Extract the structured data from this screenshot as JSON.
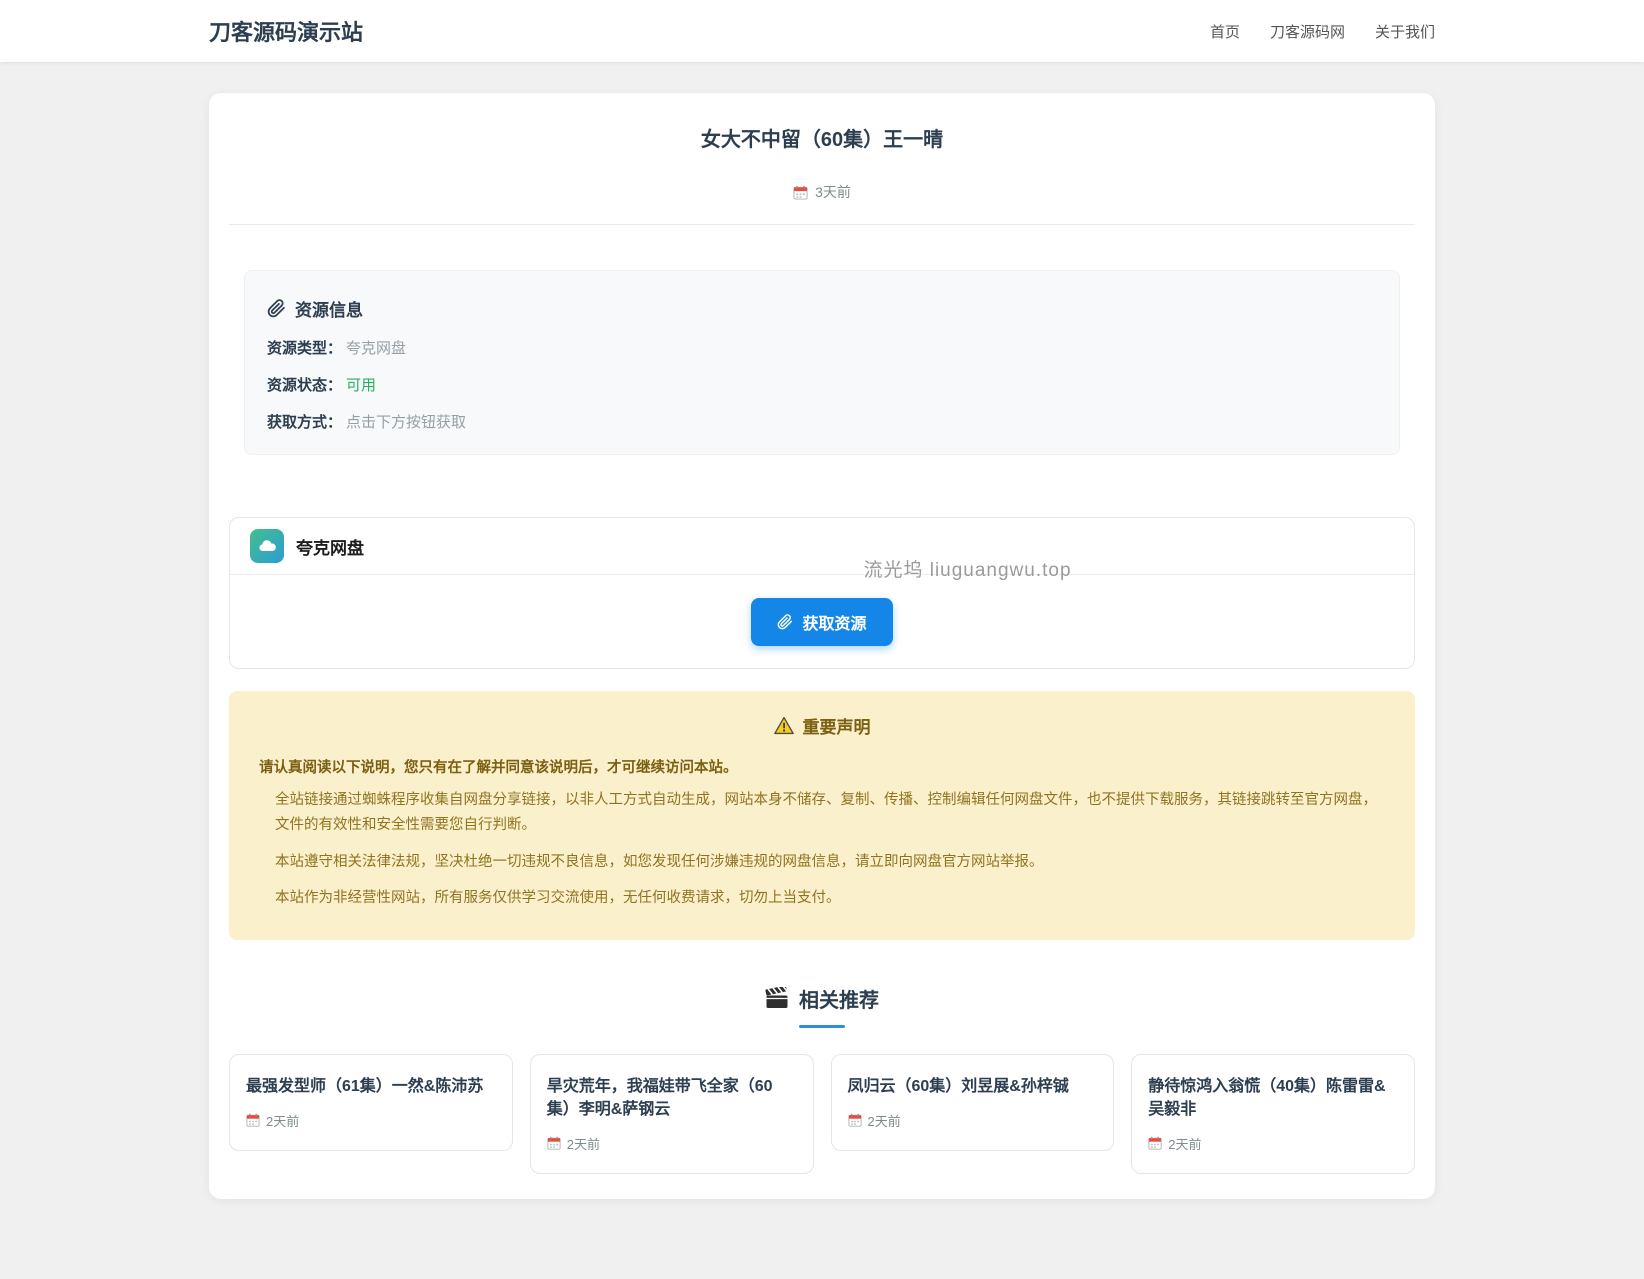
{
  "header": {
    "site_title": "刀客源码演示站",
    "nav": [
      "首页",
      "刀客源码网",
      "关于我们"
    ]
  },
  "article": {
    "title": "女大不中留（60集）王一晴",
    "date": "3天前"
  },
  "resource_info": {
    "heading": "资源信息",
    "fields": [
      {
        "label": "资源类型：",
        "value": "夸克网盘"
      },
      {
        "label": "资源状态：",
        "value": "可用"
      },
      {
        "label": "获取方式：",
        "value": "点击下方按钮获取"
      }
    ]
  },
  "pan_card": {
    "name": "夸克网盘",
    "button_label": "获取资源",
    "watermark": "流光坞 liuguangwu.top"
  },
  "notice": {
    "heading": "重要声明",
    "intro": "请认真阅读以下说明，您只有在了解并同意该说明后，才可继续访问本站。",
    "paragraphs": [
      "全站链接通过蜘蛛程序收集自网盘分享链接，以非人工方式自动生成，网站本身不储存、复制、传播、控制编辑任何网盘文件，也不提供下载服务，其链接跳转至官方网盘，文件的有效性和安全性需要您自行判断。",
      "本站遵守相关法律法规，坚决杜绝一切违规不良信息，如您发现任何涉嫌违规的网盘信息，请立即向网盘官方网站举报。",
      "本站作为非经营性网站，所有服务仅供学习交流使用，无任何收费请求，切勿上当支付。"
    ]
  },
  "related": {
    "heading": "相关推荐",
    "items": [
      {
        "title": "最强发型师（61集）一然&陈沛苏",
        "date": "2天前"
      },
      {
        "title": "旱灾荒年，我福娃带飞全家（60集）李明&萨钢云",
        "date": "2天前"
      },
      {
        "title": "凤归云（60集）刘昱展&孙梓铖",
        "date": "2天前"
      },
      {
        "title": "静待惊鸿入翁慌（40集）陈雷雷&吴毅非",
        "date": "2天前"
      }
    ]
  },
  "icons": {
    "resource_heading": "paperclip-icon",
    "date": "calendar-icon",
    "pan": "cloud-icon",
    "button": "paperclip-icon",
    "notice": "warning-icon",
    "related": "clapperboard-icon"
  },
  "colors": {
    "accent_blue": "#1486e8",
    "underline_blue": "#2e8fd6",
    "success_green": "#27ae60",
    "notice_bg": "#fbf0cc",
    "notice_text": "#8f7420",
    "title_navy": "#2c3e50",
    "muted_gray": "#95a0a6",
    "pan_icon_gradient": [
      "#43c08a",
      "#2e9bd6"
    ]
  }
}
